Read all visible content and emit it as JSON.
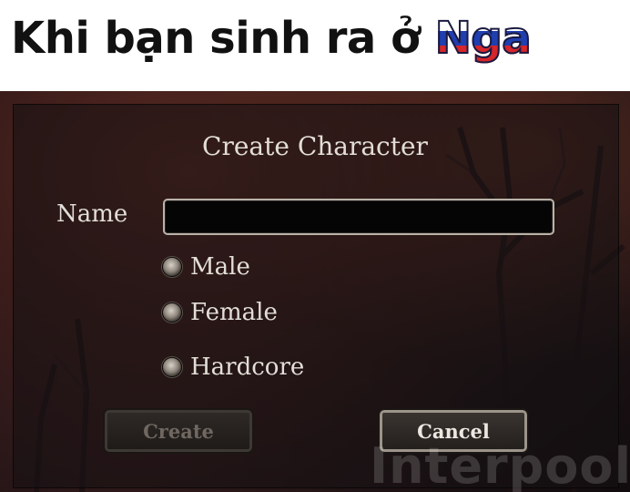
{
  "caption": {
    "prefix": "Khi bạn sinh ra ở ",
    "highlight": "Nga"
  },
  "dialog": {
    "title": "Create Character",
    "name_label": "Name",
    "name_value": "",
    "options": [
      {
        "label": "Male"
      },
      {
        "label": "Female"
      },
      {
        "label": "Hardcore"
      }
    ],
    "create_label": "Create",
    "cancel_label": "Cancel"
  },
  "watermark": "Interpool",
  "colors": {
    "caption_text": "#111111",
    "flag_white": "#ffffff",
    "flag_blue": "#1f3fb0",
    "flag_red": "#d4262b",
    "dialog_text": "#e2ded6",
    "disabled_text": "#6f6760"
  }
}
